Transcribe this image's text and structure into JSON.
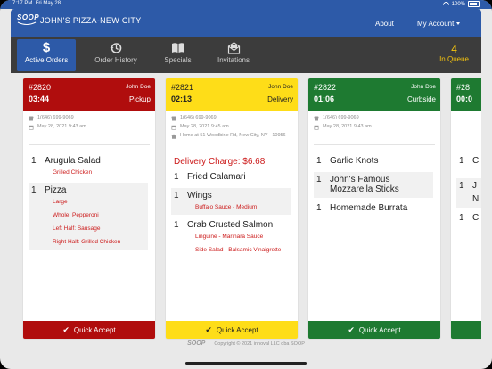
{
  "status_bar": {
    "time": "7:17 PM",
    "date": "Fri May 28",
    "battery": "100%"
  },
  "nav": {
    "logo_text": "SOOP",
    "restaurant": "JOHN'S PIZZA-NEW CITY",
    "about": "About",
    "account": "My Account"
  },
  "toolbar": {
    "tabs": [
      {
        "label": "Active Orders",
        "icon": "dollar-icon"
      },
      {
        "label": "Order History",
        "icon": "history-icon"
      },
      {
        "label": "Specials",
        "icon": "book-icon"
      },
      {
        "label": "Invitations",
        "icon": "envelope-icon"
      }
    ],
    "queue_count": "4",
    "queue_label": "In Queue"
  },
  "orders": [
    {
      "number": "#2820",
      "time": "03:44",
      "customer": "John Doe",
      "type": "Pickup",
      "phone": "1(646) 699-9069",
      "date": "May 28, 2021 9:43 am",
      "items": [
        {
          "qty": "1",
          "name": "Arugula Salad",
          "mods": [
            "Grilled Chicken"
          ]
        },
        {
          "qty": "1",
          "name": "Pizza",
          "mods": [
            "Large",
            "Whole: Pepperoni",
            "Left Half: Sausage",
            "Right Half: Grilled Chicken"
          ]
        }
      ],
      "accept": "Quick Accept"
    },
    {
      "number": "#2821",
      "time": "02:13",
      "customer": "John Doe",
      "type": "Delivery",
      "phone": "1(646) 699-9069",
      "date": "May 28, 2021 9:45 am",
      "address": "Home at 51 Woodbine Rd, New City, NY - 10956",
      "delivery_charge": "Delivery Charge: $6.68",
      "items": [
        {
          "qty": "1",
          "name": "Fried Calamari",
          "mods": []
        },
        {
          "qty": "1",
          "name": "Wings",
          "mods": [
            "Buffalo Sauce - Medium"
          ]
        },
        {
          "qty": "1",
          "name": "Crab Crusted Salmon",
          "mods": [
            "Linguine - Marinara Sauce",
            "Side Salad - Balsamic Vinaigrette"
          ]
        }
      ],
      "accept": "Quick Accept"
    },
    {
      "number": "#2822",
      "time": "01:06",
      "customer": "John Doe",
      "type": "Curbside",
      "phone": "1(646) 699-9069",
      "date": "May 28, 2021 9:43 am",
      "items": [
        {
          "qty": "1",
          "name": "Garlic Knots",
          "mods": []
        },
        {
          "qty": "1",
          "name": "John's Famous Mozzarella Sticks",
          "mods": []
        },
        {
          "qty": "1",
          "name": "Homemade Burrata",
          "mods": []
        }
      ],
      "accept": "Quick Accept"
    },
    {
      "number": "#28",
      "time": "00:0",
      "partial_items": [
        {
          "qty": "1",
          "name": "C"
        },
        {
          "qty": "1",
          "name": "J"
        },
        {
          "qty": "",
          "name": "N"
        },
        {
          "qty": "1",
          "name": "C"
        }
      ],
      "accept": ""
    }
  ],
  "footer": {
    "logo": "SOOP",
    "copyright": "Copyright © 2021 innoval LLC dba SOOP"
  }
}
